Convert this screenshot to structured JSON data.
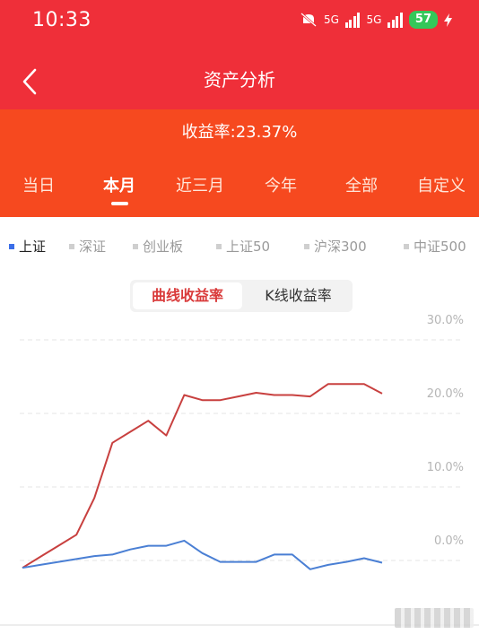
{
  "status": {
    "time": "10:33",
    "net1": "5G",
    "net2": "5G",
    "battery": "57"
  },
  "header": {
    "title": "资产分析"
  },
  "summary": {
    "yield_text": "收益率:23.37%"
  },
  "period_tabs": [
    "当日",
    "本月",
    "近三月",
    "今年",
    "全部",
    "自定义"
  ],
  "active_period_index": 1,
  "index_filters": [
    "上证",
    "深证",
    "创业板",
    "上证50",
    "沪深300",
    "中证500"
  ],
  "active_index_index": 0,
  "segment": {
    "option_a": "曲线收益率",
    "option_b": "K线收益率",
    "active": 0
  },
  "colors": {
    "header_red": "#ef2f39",
    "band_orange": "#f6491f",
    "portfolio_line": "#c8403f",
    "index_line": "#4a7fd4"
  },
  "chart_data": {
    "type": "line",
    "y_ticks": [
      "30.0%",
      "20.0%",
      "10.0%",
      "0.0%"
    ],
    "ylim": [
      -10,
      30
    ],
    "grid": true,
    "series": [
      {
        "name": "",
        "values": [
          -1.0,
          0.5,
          2.0,
          3.5,
          8.5,
          16.0,
          17.5,
          19.0,
          17.0,
          22.5,
          21.8,
          21.8,
          22.3,
          22.8,
          22.5,
          22.5,
          22.3,
          24.0,
          24.0,
          24.0,
          22.7
        ]
      },
      {
        "name": "",
        "values": [
          -1.0,
          -0.6,
          -0.2,
          0.2,
          0.6,
          0.8,
          1.5,
          2.0,
          2.0,
          2.7,
          1.0,
          -0.2,
          -0.2,
          -0.2,
          0.8,
          0.8,
          -1.2,
          -0.6,
          -0.2,
          0.3,
          -0.3
        ]
      }
    ]
  }
}
